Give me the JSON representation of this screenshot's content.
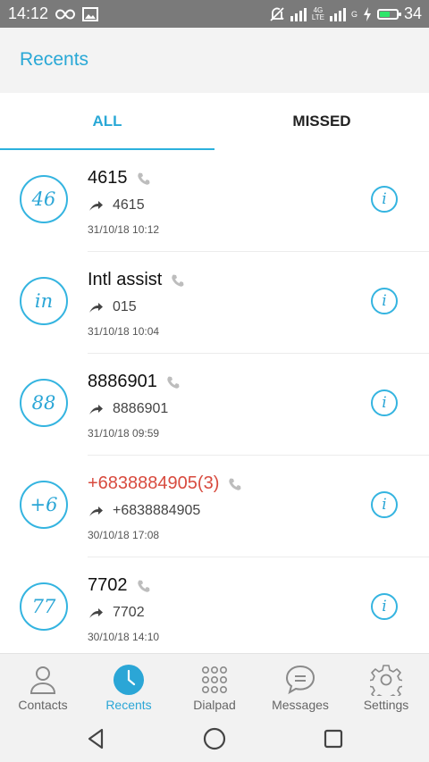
{
  "status_bar": {
    "time": "14:12",
    "network_4g": "4G",
    "network_lte": "LTE",
    "network_g": "G",
    "battery_percent": "34",
    "battery_level": 0.6
  },
  "header": {
    "title": "Recents"
  },
  "tabs": [
    {
      "label": "ALL",
      "active": true
    },
    {
      "label": "MISSED",
      "active": false
    }
  ],
  "calls": [
    {
      "avatar": "46",
      "name": "4615",
      "number": "4615",
      "datetime": "31/10/18 10:12",
      "missed": false
    },
    {
      "avatar": "in",
      "name": "Intl assist",
      "number": "015",
      "datetime": "31/10/18 10:04",
      "missed": false
    },
    {
      "avatar": "88",
      "name": "8886901",
      "number": "8886901",
      "datetime": "31/10/18 09:59",
      "missed": false
    },
    {
      "avatar": "+6",
      "name": "+6838884905(3)",
      "number": "+6838884905",
      "datetime": "30/10/18 17:08",
      "missed": true
    },
    {
      "avatar": "77",
      "name": "7702",
      "number": "7702",
      "datetime": "30/10/18 14:10",
      "missed": false
    }
  ],
  "bottom_nav": [
    {
      "label": "Contacts",
      "icon": "person-icon",
      "active": false
    },
    {
      "label": "Recents",
      "icon": "clock-icon",
      "active": true
    },
    {
      "label": "Dialpad",
      "icon": "dialpad-icon",
      "active": false
    },
    {
      "label": "Messages",
      "icon": "message-icon",
      "active": false
    },
    {
      "label": "Settings",
      "icon": "gear-icon",
      "active": false
    }
  ],
  "colors": {
    "accent": "#2ba6d6",
    "missed": "#d84b3f",
    "status_bar": "#7a7a7a",
    "battery": "#2ee66b"
  }
}
